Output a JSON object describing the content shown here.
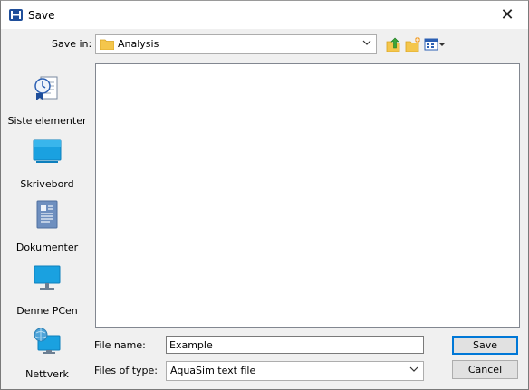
{
  "window": {
    "title": "Save",
    "close_glyph": "✕"
  },
  "save_in": {
    "label": "Save in:",
    "value": "Analysis"
  },
  "toolbar": {
    "icons": [
      "up-folder-icon",
      "new-folder-icon",
      "view-menu-icon"
    ]
  },
  "places": [
    {
      "label": "Siste elementer",
      "icon": "recent-items-icon"
    },
    {
      "label": "Skrivebord",
      "icon": "desktop-icon"
    },
    {
      "label": "Dokumenter",
      "icon": "documents-icon"
    },
    {
      "label": "Denne PCen",
      "icon": "this-pc-icon"
    },
    {
      "label": "Nettverk",
      "icon": "network-icon"
    }
  ],
  "file_name": {
    "label": "File name:",
    "value": "Example"
  },
  "file_type": {
    "label": "Files of type:",
    "value": "AquaSim text file"
  },
  "buttons": {
    "save": "Save",
    "cancel": "Cancel"
  },
  "colors": {
    "accent": "#0078d7",
    "folder": "#f4c64c",
    "titlebar": "#ffffff",
    "dialog_bg": "#f0f0f0"
  }
}
